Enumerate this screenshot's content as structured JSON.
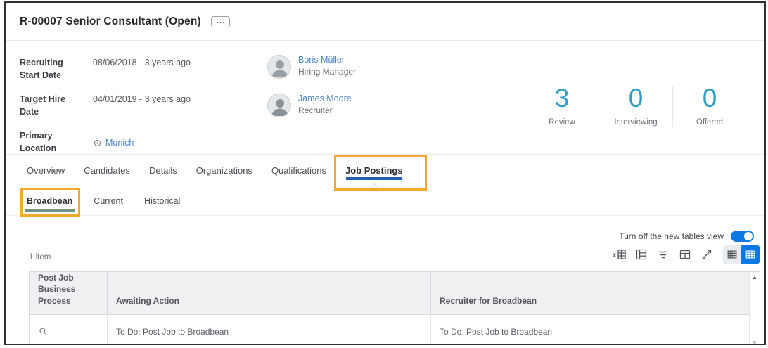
{
  "colors": {
    "accent": "#0b78e3",
    "link": "#4a86c8",
    "stat": "#2f9dc7",
    "tab-underline": "#2160b0",
    "subtab-underline": "#6f9383",
    "annotation": "#f2a92d"
  },
  "header": {
    "title": "R-00007 Senior Consultant (Open)",
    "more": "…"
  },
  "fields": [
    {
      "label": "Recruiting Start Date",
      "value": "08/06/2018 - 3 years ago"
    },
    {
      "label": "Target Hire Date",
      "value": "04/01/2019 - 3 years ago"
    },
    {
      "label": "Primary Location",
      "value": "Munich"
    }
  ],
  "people": [
    {
      "name": "Boris Müller",
      "role": "Hiring Manager"
    },
    {
      "name": "James Moore",
      "role": "Recruiter"
    }
  ],
  "stats": [
    {
      "count": "3",
      "label": "Review"
    },
    {
      "count": "0",
      "label": "Interviewing"
    },
    {
      "count": "0",
      "label": "Offered"
    }
  ],
  "tabs": {
    "items": [
      {
        "label": "Overview"
      },
      {
        "label": "Candidates"
      },
      {
        "label": "Details"
      },
      {
        "label": "Organizations"
      },
      {
        "label": "Qualifications"
      },
      {
        "label": "Job Postings"
      }
    ],
    "active": "Job Postings"
  },
  "subtabs": {
    "items": [
      {
        "label": "Broadbean"
      },
      {
        "label": "Current"
      },
      {
        "label": "Historical"
      }
    ],
    "active": "Broadbean"
  },
  "table_area": {
    "toggle_label": "Turn off the new tables view",
    "toggle_state": "on",
    "item_count": "1 item",
    "toolbar_icon_names": [
      "export-to-excel",
      "grid-view",
      "filter",
      "column-options",
      "expand",
      "compact-grid",
      "comfortable-grid"
    ],
    "scroll_up": "▲",
    "scroll_down": "▼"
  },
  "table": {
    "columns": [
      "Post Job Business Process",
      "Awaiting Action",
      "Recruiter for Broadbean"
    ],
    "rows": [
      {
        "post_job_business_process_icon": "magnifier",
        "awaiting_action": "To Do: Post Job to Broadbean",
        "recruiter_for_broadbean": "To Do: Post Job to Broadbean"
      }
    ]
  }
}
